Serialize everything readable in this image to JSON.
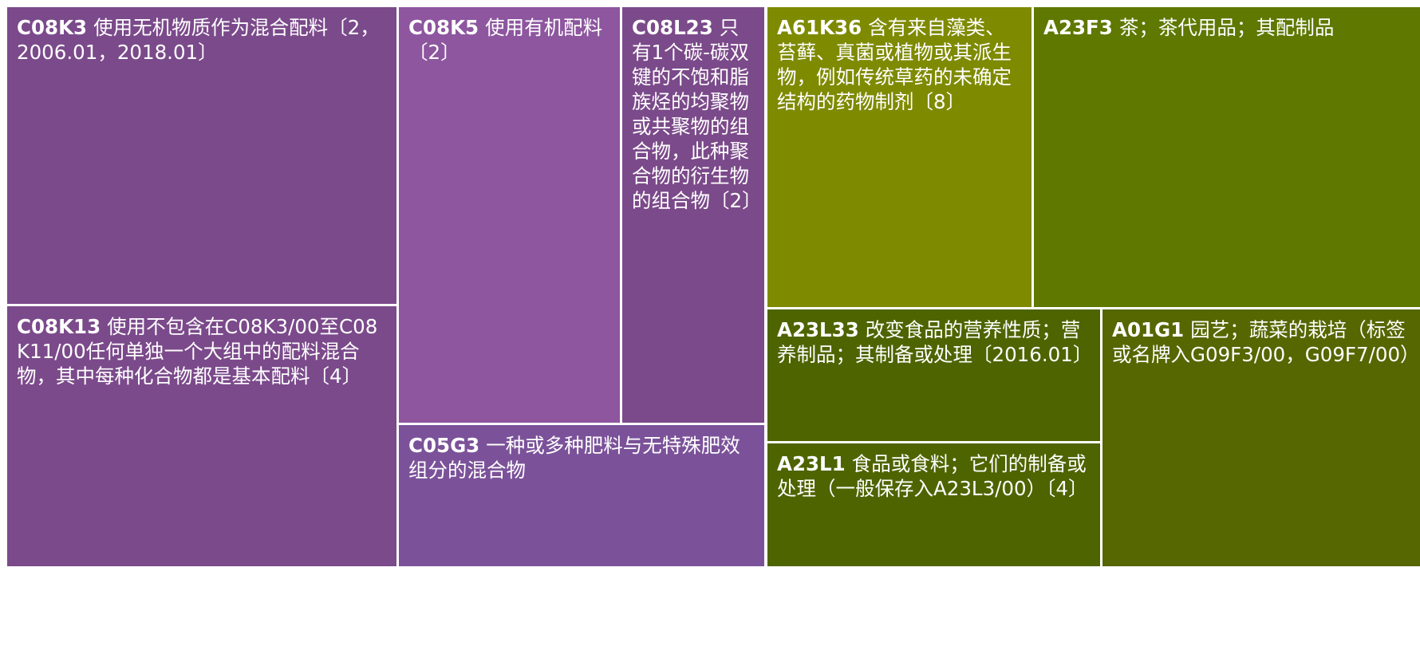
{
  "chart_data": {
    "type": "treemap",
    "colors": {
      "purple_dark": "#7b4a8b",
      "purple_light": "#8d569f",
      "purple_medium": "#7b4a8a",
      "purple_blue": "#7b5299",
      "olive_light": "#7e8a00",
      "olive_medium": "#5e7800",
      "olive_dark": "#4e6400",
      "olive_darker": "#566600"
    },
    "tiles": [
      {
        "code": "C08K3",
        "label": "使用无机物质作为混合配料〔2，2006.01，2018.01〕",
        "color": "purple_dark"
      },
      {
        "code": "C08K13",
        "label": "使用不包含在C08K3/00至C08K11/00任何单独一个大组中的配料混合物，其中每种化合物都是基本配料〔4〕",
        "color": "purple_dark"
      },
      {
        "code": "C08K5",
        "label": "使用有机配料〔2〕",
        "color": "purple_light"
      },
      {
        "code": "C08L23",
        "label": "只有1个碳-碳双键的不饱和脂族烃的均聚物或共聚物的组合物，此种聚合物的衍生物的组合物〔2〕",
        "color": "purple_medium"
      },
      {
        "code": "C05G3",
        "label": "一种或多种肥料与无特殊肥效组分的混合物",
        "color": "purple_blue"
      },
      {
        "code": "A61K36",
        "label": "含有来自藻类、苔藓、真菌或植物或其派生物，例如传统草药的未确定结构的药物制剂〔8〕",
        "color": "olive_light"
      },
      {
        "code": "A23F3",
        "label": "茶；茶代用品；其配制品",
        "color": "olive_medium"
      },
      {
        "code": "A23L33",
        "label": "改变食品的营养性质；营养制品；其制备或处理〔2016.01〕",
        "color": "olive_dark"
      },
      {
        "code": "A23L1",
        "label": "食品或食料；它们的制备或处理（一般保存入A23L3/00）〔4〕",
        "color": "olive_dark"
      },
      {
        "code": "A01G1",
        "label": "园艺；蔬菜的栽培（标签或名牌入G09F3/00，G09F7/00）",
        "color": "olive_darker"
      }
    ]
  }
}
